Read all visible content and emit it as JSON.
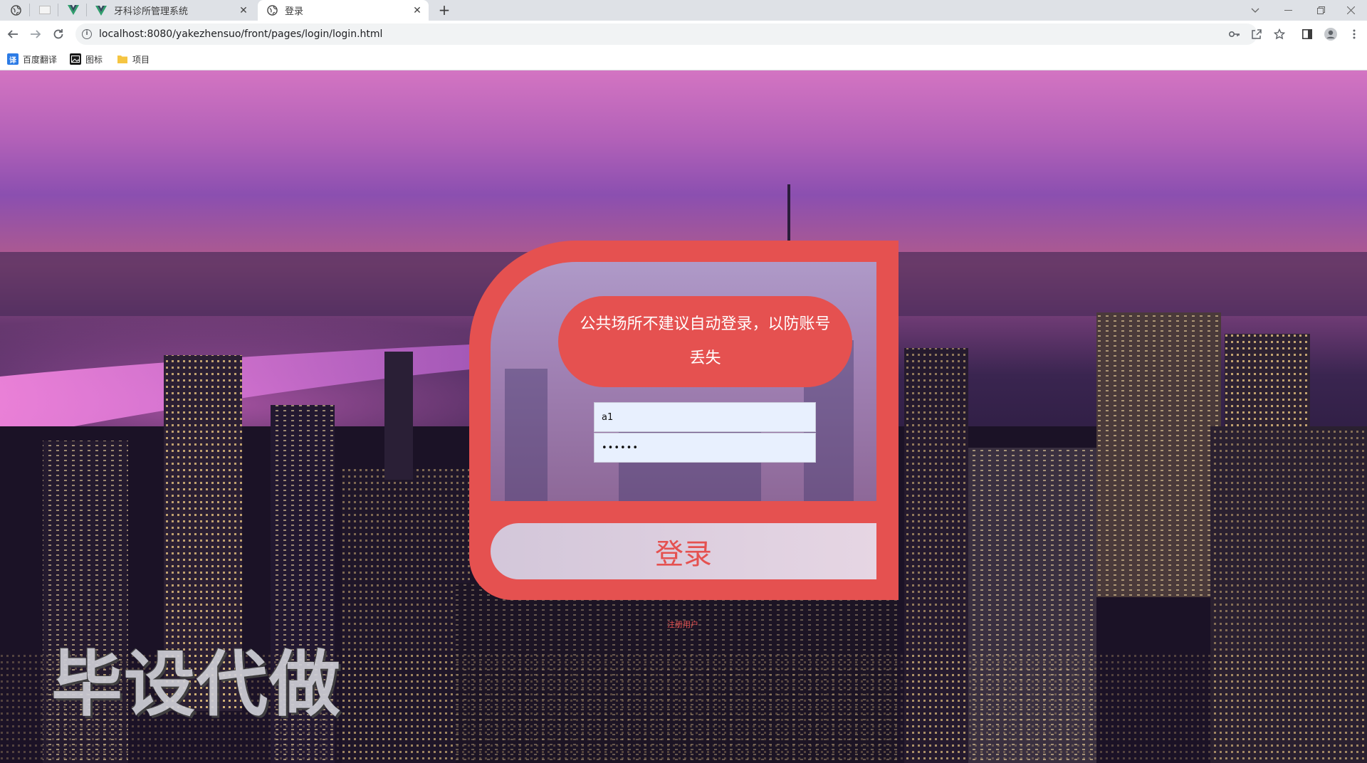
{
  "browser": {
    "tabs": [
      {
        "label": "牙科诊所管理系统"
      },
      {
        "label": "登录"
      }
    ],
    "new_tab_label": "+",
    "url": "localhost:8080/yakezhensuo/front/pages/login/login.html",
    "bookmarks": [
      {
        "label": "百度翻译",
        "icon_text": "译",
        "color": "#2c7be5"
      },
      {
        "label": "图标",
        "icon_text": "▣",
        "color": "#1a1a1a"
      },
      {
        "label": "项目",
        "icon_text": "",
        "color": "#f5c542"
      }
    ]
  },
  "login": {
    "notice": "公共场所不建议自动登录，以防账号丢失",
    "username_value": "a1",
    "password_value": "••••••",
    "button_label": "登录",
    "register_link": "注册用户"
  },
  "watermark": "毕设代做",
  "colors": {
    "accent": "#e55150",
    "input_bg": "#e8f0fe"
  }
}
